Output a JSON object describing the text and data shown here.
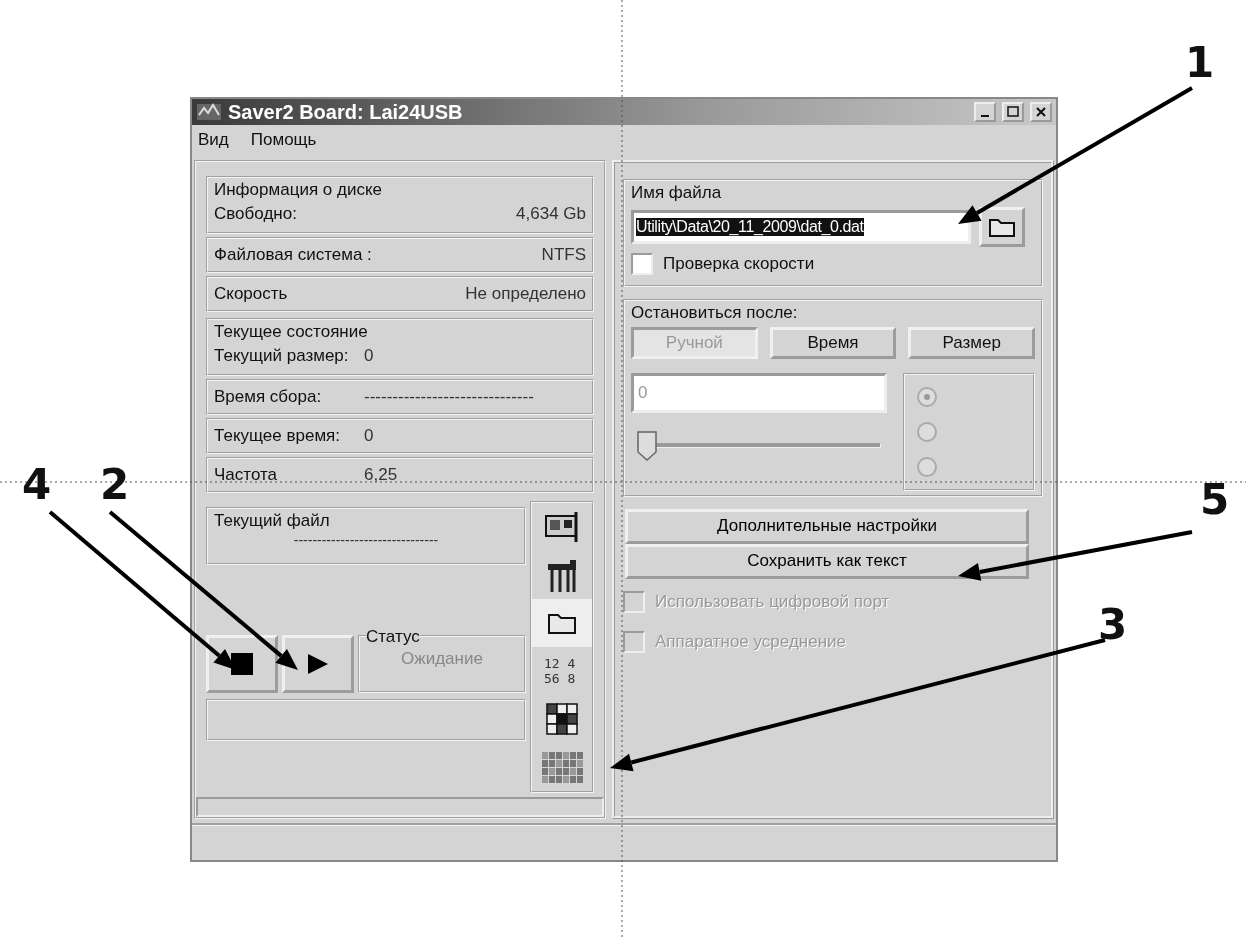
{
  "window": {
    "title": "Saver2 Board: Lai24USB"
  },
  "menu": [
    "Вид",
    "Помощь"
  ],
  "disk_info": {
    "title": "Информация о диске",
    "rows": [
      {
        "label": "Свободно:",
        "value": "4,634 Gb"
      },
      {
        "label": "Файловая система :",
        "value": "NTFS"
      },
      {
        "label": "Скорость",
        "value": "Не определено"
      }
    ]
  },
  "current_state": {
    "title": "Текущее состояние",
    "rows": [
      {
        "label": "Текущий размер:",
        "value": "0"
      },
      {
        "label": "Время сбора:",
        "value": "------------------------------"
      },
      {
        "label": "Текущее время:",
        "value": "0"
      },
      {
        "label": "Частота",
        "value": "6,25"
      }
    ]
  },
  "current_file": {
    "title": "Текущий файл",
    "value": "-------------------------------"
  },
  "status": {
    "title": "Статус",
    "value": "Ожидание"
  },
  "side_tabs": [
    {
      "kind": "board",
      "selected": false
    },
    {
      "kind": "tools",
      "selected": false
    },
    {
      "kind": "folder",
      "selected": true
    },
    {
      "kind": "numbers",
      "selected": false,
      "lines": [
        "12 4",
        "56 8"
      ]
    },
    {
      "kind": "grid",
      "selected": false
    },
    {
      "kind": "matrix",
      "selected": false
    }
  ],
  "file_name": {
    "title": "Имя файла",
    "value": "Utility\\Data\\20_11_2009\\dat_0.dat"
  },
  "speed_check": {
    "label": "Проверка скорости",
    "checked": false
  },
  "stop_after": {
    "title": "Остановиться после:",
    "modes": [
      {
        "label": "Ручной",
        "selected": true
      },
      {
        "label": "Время",
        "selected": false
      },
      {
        "label": "Размер",
        "selected": false
      }
    ],
    "amount": "0",
    "slider": {
      "level": 0
    },
    "radios": [
      {
        "selected": true
      },
      {
        "selected": false
      },
      {
        "selected": false
      }
    ]
  },
  "buttons": [
    "Дополнительные настройки",
    "Сохранить как текст"
  ],
  "options": [
    {
      "label": "Использовать цифровой порт",
      "checked": false
    },
    {
      "label": "Аппаратное усреднение",
      "checked": false
    }
  ],
  "callouts": [
    {
      "label": "1"
    },
    {
      "label": "2"
    },
    {
      "label": "3"
    },
    {
      "label": "4"
    },
    {
      "label": "5"
    }
  ]
}
